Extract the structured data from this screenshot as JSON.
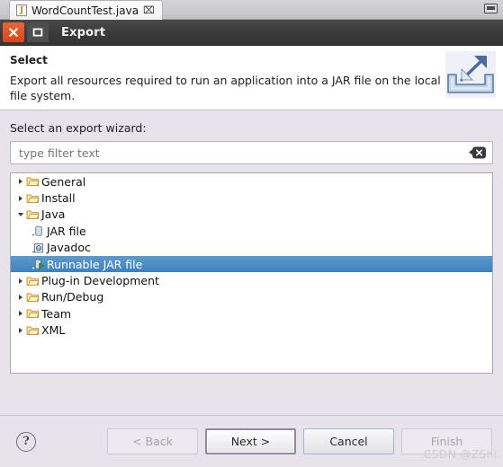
{
  "editor": {
    "tab_label": "WordCountTest.java",
    "tab_close_glyph": "⌧",
    "file_icon": "java-file-icon"
  },
  "dialog": {
    "window_title": "Export",
    "close_glyph": "✕",
    "maximize_glyph": "□"
  },
  "header": {
    "title": "Select",
    "description": "Export all resources required to run an application into a JAR file on the local file system.",
    "icon": "export-arrow-icon"
  },
  "form": {
    "wizard_label": "Select an export wizard:",
    "filter_placeholder": "type filter text",
    "filter_value": "",
    "clear_icon": "clear-filter-icon"
  },
  "tree": {
    "items": [
      {
        "label": "General",
        "level": 0,
        "state": "collapsed",
        "icon": "folder-icon",
        "selected": false
      },
      {
        "label": "Install",
        "level": 0,
        "state": "collapsed",
        "icon": "folder-icon",
        "selected": false
      },
      {
        "label": "Java",
        "level": 0,
        "state": "expanded",
        "icon": "folder-icon",
        "selected": false
      },
      {
        "label": "JAR file",
        "level": 1,
        "state": "leaf",
        "icon": "jar-file-icon",
        "selected": false
      },
      {
        "label": "Javadoc",
        "level": 1,
        "state": "leaf",
        "icon": "javadoc-icon",
        "selected": false
      },
      {
        "label": "Runnable JAR file",
        "level": 1,
        "state": "leaf",
        "icon": "runnable-jar-icon",
        "selected": true
      },
      {
        "label": "Plug-in Development",
        "level": 0,
        "state": "collapsed",
        "icon": "folder-icon",
        "selected": false
      },
      {
        "label": "Run/Debug",
        "level": 0,
        "state": "collapsed",
        "icon": "folder-icon",
        "selected": false
      },
      {
        "label": "Team",
        "level": 0,
        "state": "collapsed",
        "icon": "folder-icon",
        "selected": false
      },
      {
        "label": "XML",
        "level": 0,
        "state": "collapsed",
        "icon": "folder-icon",
        "selected": false
      }
    ],
    "selection_color": "#3f82bb"
  },
  "footer": {
    "help_label": "?",
    "back_label": "< Back",
    "next_label": "Next >",
    "cancel_label": "Cancel",
    "finish_label": "Finish",
    "back_enabled": false,
    "next_enabled": true,
    "cancel_enabled": true,
    "finish_enabled": false
  },
  "watermark": {
    "text": "CSDN @ZShi."
  }
}
